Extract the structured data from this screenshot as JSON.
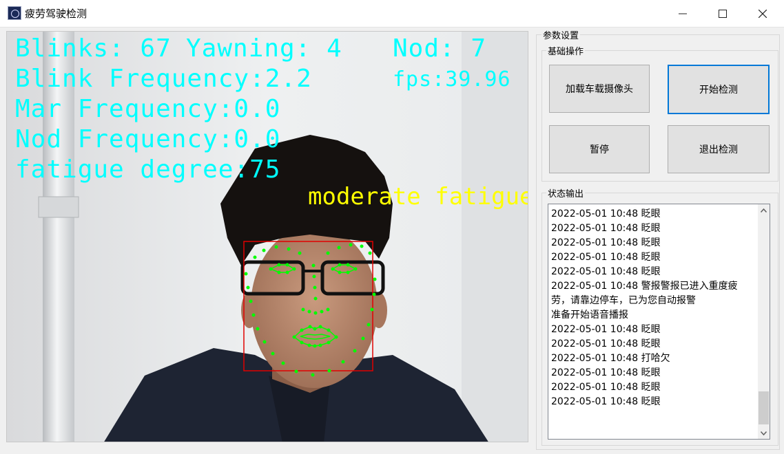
{
  "window": {
    "title": "疲劳驾驶检测",
    "controls": [
      "minimize",
      "maximize",
      "close"
    ]
  },
  "video": {
    "blinks": "Blinks: 67",
    "yawning": "Yawning: 4",
    "nod": "Nod: 7",
    "blink_frequency": "Blink Frequency:2.2",
    "fps": "fps:39.96",
    "mar_frequency": "Mar Frequency:0.0",
    "nod_frequency": "Nod Frequency:0.0",
    "fatigue_degree": "fatigue degree:75",
    "fatigue_status": "moderate fatigue"
  },
  "panel": {
    "title": "参数设置",
    "basic_group": "基础操作",
    "buttons": {
      "load_camera": "加载车载摄像头",
      "start": "开始检测",
      "pause": "暂停",
      "exit": "退出检测"
    },
    "status_group": "状态输出",
    "log": [
      "2022-05-01 10:48 眨眼",
      "2022-05-01 10:48 眨眼",
      "2022-05-01 10:48 眨眼",
      "2022-05-01 10:48 眨眼",
      "2022-05-01 10:48 眨眼",
      "2022-05-01 10:48 警报警报已进入重度疲劳，请靠边停车，已为您自动报警",
      "准备开始语音播报",
      "2022-05-01 10:48 眨眼",
      "2022-05-01 10:48 眨眼",
      "2022-05-01 10:48 打哈欠",
      "2022-05-01 10:48 眨眼",
      "2022-05-01 10:48 眨眼",
      "2022-05-01 10:48 眨眼"
    ]
  },
  "colors": {
    "overlay_text": "#00ffff",
    "fatigue_text": "#ffff00",
    "face_box": "#e00000",
    "landmarks": "#00ff00",
    "accent": "#0078d7"
  }
}
